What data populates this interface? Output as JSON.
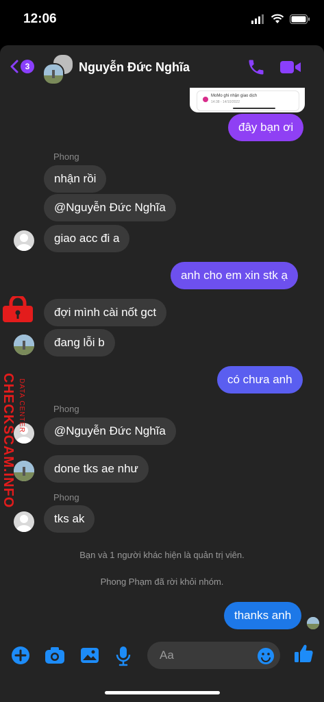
{
  "status": {
    "time": "12:06"
  },
  "header": {
    "badge": "3",
    "title": "Nguyễn Đức Nghĩa"
  },
  "shared_image": {
    "line1": "MoMo ghi nhận giao dịch",
    "line2": "14:38 - 14/10/2022"
  },
  "messages": [
    {
      "text": "đây bạn ơi",
      "dir": "out"
    },
    {
      "sender": "Phong"
    },
    {
      "text": "nhận rồi",
      "dir": "in"
    },
    {
      "text": "@Nguyễn Đức Nghĩa",
      "dir": "in"
    },
    {
      "text": "giao acc đi a",
      "dir": "in"
    },
    {
      "text": "anh cho em xin stk ạ",
      "dir": "out"
    },
    {
      "text": "đợi mình cài nốt gct",
      "dir": "in"
    },
    {
      "text": "đang lỗi b",
      "dir": "in"
    },
    {
      "text": "có chưa anh",
      "dir": "out"
    },
    {
      "sender": "Phong"
    },
    {
      "text": "@Nguyễn Đức Nghĩa",
      "dir": "in"
    },
    {
      "text": "done tks ae như",
      "dir": "in"
    },
    {
      "sender": "Phong"
    },
    {
      "text": "tks ak",
      "dir": "in"
    },
    {
      "text": "thanks anh",
      "dir": "out"
    }
  ],
  "system": [
    "Bạn và 1 người khác hiện là quản trị viên.",
    "Phong Phạm đã rời khỏi nhóm."
  ],
  "watermark": {
    "main": "CHECKSCAM.INFO",
    "sub": "DATA CENTER"
  },
  "composer": {
    "placeholder": "Aa"
  },
  "colors": {
    "accent": "#8a3ffc",
    "bubble_in": "#3a3a3a",
    "composer_icon": "#1d8cf8"
  }
}
